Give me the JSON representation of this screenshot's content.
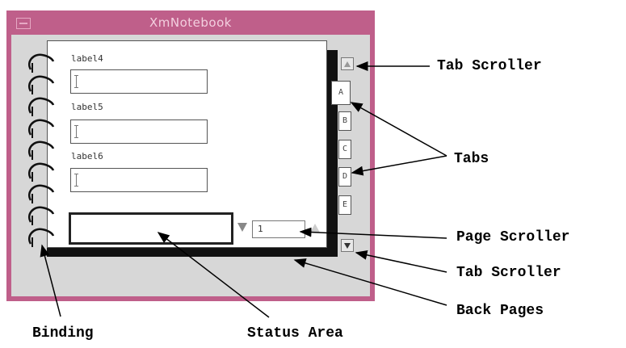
{
  "window": {
    "title": "XmNotebook"
  },
  "form": {
    "fields": [
      {
        "label": "label4",
        "value": ""
      },
      {
        "label": "label5",
        "value": ""
      },
      {
        "label": "label6",
        "value": ""
      }
    ]
  },
  "page_scroller": {
    "value": "1"
  },
  "tabs": [
    "A",
    "B",
    "C",
    "D",
    "E"
  ],
  "callouts": {
    "tab_scroller_top": "Tab Scroller",
    "tabs": "Tabs",
    "page_scroller": "Page Scroller",
    "tab_scroller_bottom": "Tab Scroller",
    "back_pages": "Back Pages",
    "binding": "Binding",
    "status_area": "Status Area"
  },
  "colors": {
    "frame": "#bf5f8a",
    "title_text": "#f3cfdf",
    "client_bg": "#d7d7d7"
  }
}
